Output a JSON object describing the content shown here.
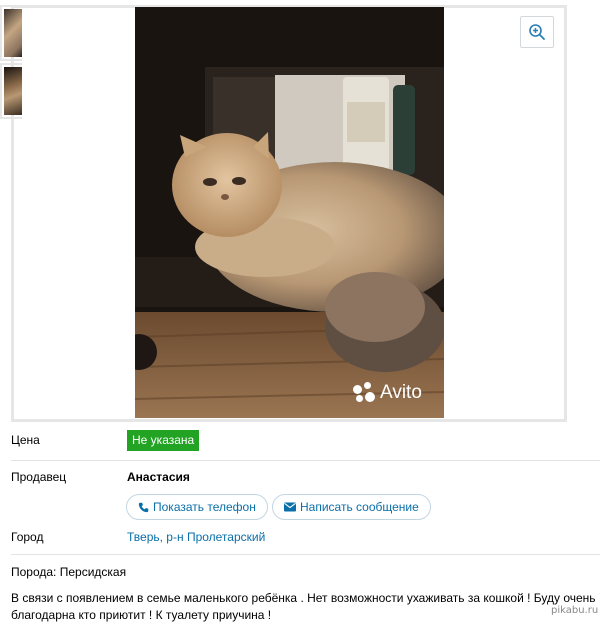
{
  "gallery": {
    "main_photo_alt": "cat-photo",
    "watermark_text": "Avito",
    "zoom_icon": "zoom-in-icon"
  },
  "details": {
    "price_label": "Цена",
    "price_value": "Не указана",
    "seller_label": "Продавец",
    "seller_name": "Анастасия",
    "show_phone_label": "Показать телефон",
    "write_message_label": "Написать сообщение",
    "city_label": "Город",
    "city_value": "Тверь, р-н Пролетарский"
  },
  "description": {
    "breed": "Порода: Персидская",
    "text": "В связи с появлением в семье маленького ребёнка . Нет возможности ухаживать за кошкой ! Буду очень благодарна кто приютит ! К туалету приучина !"
  },
  "watermark_site": "pikabu.ru",
  "colors": {
    "price_badge": "#22a323",
    "link": "#0a6fa8"
  }
}
